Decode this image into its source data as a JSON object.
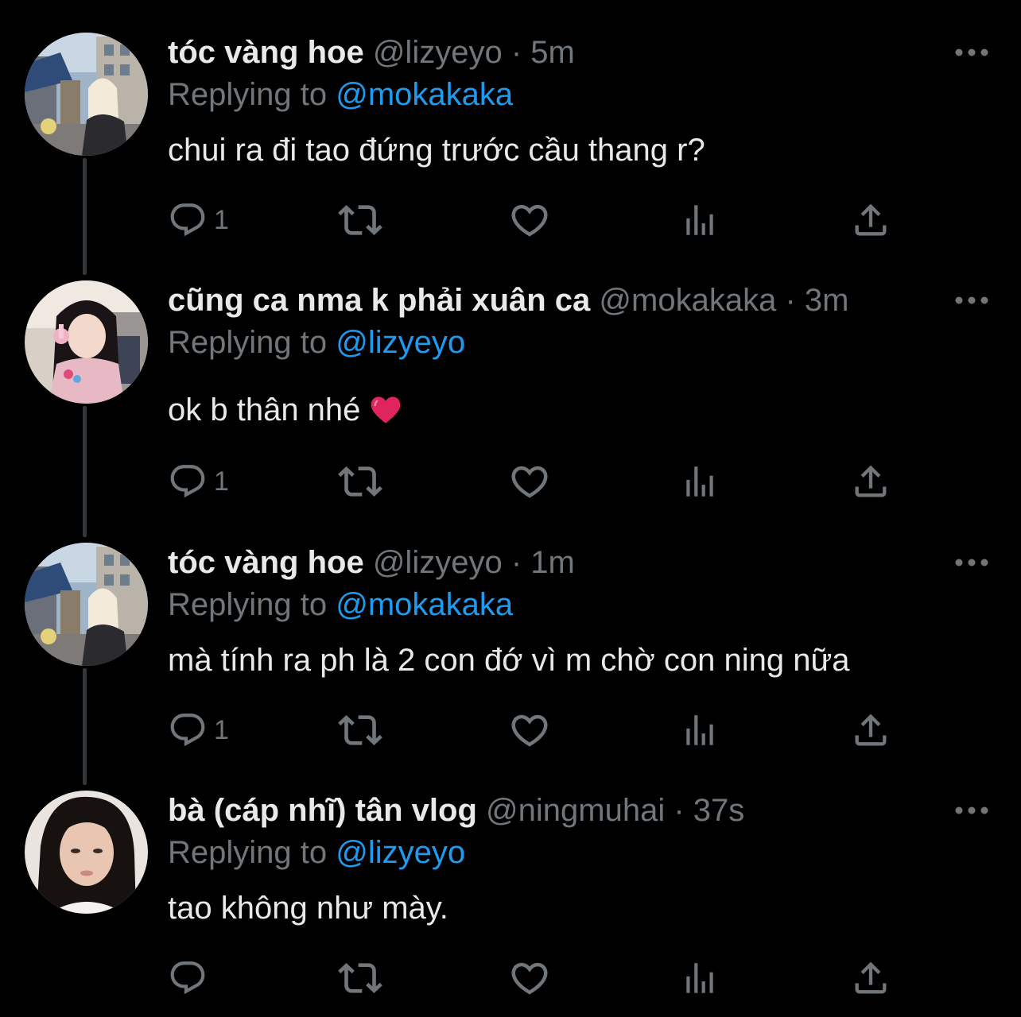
{
  "tweets": [
    {
      "display_name": "tóc vàng hoe",
      "handle": "@lizyeyo",
      "separator": "·",
      "time": "5m",
      "replying_prefix": "Replying to",
      "replying_to": "@mokakaka",
      "text": "chui ra đi tao đứng trước cầu thang r?",
      "reply_count": "1",
      "avatar": "avatar-street-photo"
    },
    {
      "display_name": "cũng ca nma k phải xuân ca",
      "handle": "@mokakaka",
      "separator": "·",
      "time": "3m",
      "replying_prefix": "Replying to",
      "replying_to": "@lizyeyo",
      "text": "ok b thân nhé",
      "emoji": "red-heart-emoji",
      "reply_count": "1",
      "avatar": "avatar-girl-pink"
    },
    {
      "display_name": "tóc vàng hoe",
      "handle": "@lizyeyo",
      "separator": "·",
      "time": "1m",
      "replying_prefix": "Replying to",
      "replying_to": "@mokakaka",
      "text": "mà tính ra ph là 2 con đớ vì m chờ con ning nữa",
      "reply_count": "1",
      "avatar": "avatar-street-photo"
    },
    {
      "display_name": "bà (cáp nhĩ) tân vlog",
      "handle": "@ningmuhai",
      "separator": "·",
      "time": "37s",
      "replying_prefix": "Replying to",
      "replying_to": "@lizyeyo",
      "text": "tao không như mày.",
      "reply_count": "",
      "avatar": "avatar-portrait"
    }
  ],
  "icons": [
    "reply-icon",
    "retweet-icon",
    "like-icon",
    "views-icon",
    "share-icon",
    "more-icon"
  ],
  "colors": {
    "background": "#000000",
    "primary_text": "#e7e9ea",
    "secondary_text": "#71767b",
    "link": "#1d9bf0",
    "thread_line": "#333639",
    "heart": "#e0245e"
  }
}
